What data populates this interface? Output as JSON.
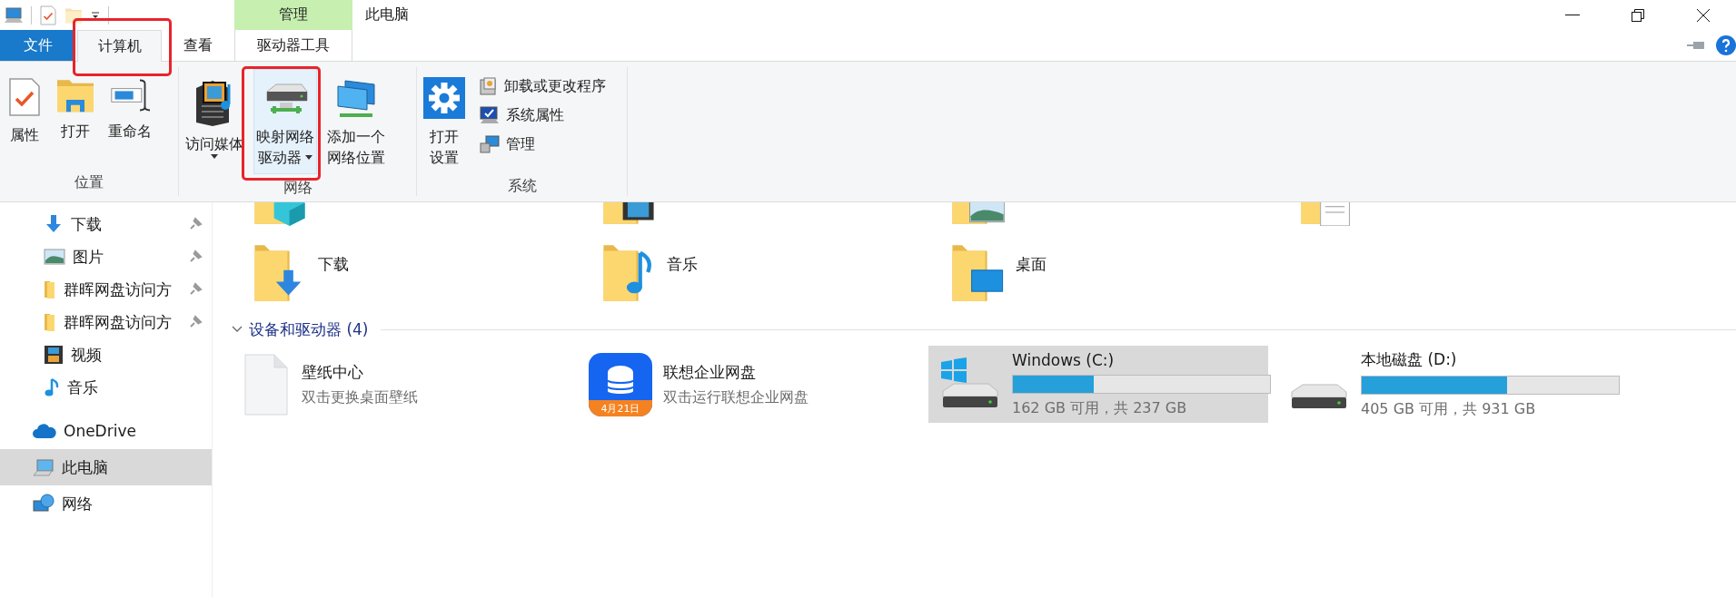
{
  "window": {
    "title": "此电脑",
    "context_header": "管理"
  },
  "tabs": [
    {
      "label": "文件",
      "kind": "file",
      "selected": false
    },
    {
      "label": "计算机",
      "kind": "normal",
      "selected": true,
      "annotated": true
    },
    {
      "label": "查看",
      "kind": "normal",
      "selected": false
    },
    {
      "label": "驱动器工具",
      "kind": "context",
      "selected": false
    }
  ],
  "ribbon": {
    "groups": [
      {
        "label": "位置",
        "commands": [
          {
            "kind": "large",
            "lines": [
              "属性"
            ]
          },
          {
            "kind": "large",
            "lines": [
              "打开"
            ]
          },
          {
            "kind": "large",
            "lines": [
              "重命名"
            ]
          }
        ]
      },
      {
        "label": "网络",
        "commands": [
          {
            "kind": "large",
            "lines": [
              "访问媒体"
            ],
            "dropdown": true
          },
          {
            "kind": "large",
            "lines": [
              "映射网络",
              "驱动器"
            ],
            "dropdown": true,
            "hovered": true,
            "annotated": true
          },
          {
            "kind": "large",
            "lines": [
              "添加一个",
              "网络位置"
            ]
          }
        ]
      },
      {
        "label": "系统",
        "commands": [
          {
            "kind": "large",
            "lines": [
              "打开",
              "设置"
            ]
          },
          {
            "kind": "small",
            "lines": [
              "卸载或更改程序"
            ]
          },
          {
            "kind": "small",
            "lines": [
              "系统属性"
            ]
          },
          {
            "kind": "small",
            "lines": [
              "管理"
            ]
          }
        ]
      }
    ]
  },
  "navigation": {
    "pinned_items": [
      {
        "label": "下载",
        "kind": "downloads",
        "pinned": true,
        "selected": false
      },
      {
        "label": "图片",
        "kind": "pictures",
        "pinned": true,
        "selected": false
      },
      {
        "label": "群晖网盘访问方",
        "kind": "folder",
        "pinned": true,
        "selected": false
      },
      {
        "label": "群晖网盘访问方",
        "kind": "folder",
        "pinned": true,
        "selected": false
      },
      {
        "label": "视频",
        "kind": "videos",
        "pinned": false,
        "selected": false
      },
      {
        "label": "音乐",
        "kind": "music",
        "pinned": false,
        "selected": false
      }
    ],
    "locations": [
      {
        "label": "OneDrive",
        "kind": "cloud",
        "selected": false
      },
      {
        "label": "此电脑",
        "kind": "computer",
        "selected": true
      },
      {
        "label": "网络",
        "kind": "network",
        "selected": false
      }
    ]
  },
  "folders": {
    "partially_visible": [
      {
        "kind": "objects3d"
      },
      {
        "kind": "videos"
      },
      {
        "kind": "pictures"
      },
      {
        "kind": "documents"
      }
    ],
    "items": [
      {
        "label": "下载",
        "kind": "downloads"
      },
      {
        "label": "音乐",
        "kind": "music"
      },
      {
        "label": "桌面",
        "kind": "desktop"
      }
    ]
  },
  "devices": {
    "header": "设备和驱动器 (4)",
    "expanded": true,
    "items": [
      {
        "kind": "shortcut",
        "name": "壁纸中心",
        "description": "双击更换桌面壁纸",
        "selected": false
      },
      {
        "kind": "app",
        "name": "联想企业网盘",
        "description": "双击运行联想企业网盘",
        "badge": "4月21日",
        "selected": false
      },
      {
        "kind": "drive",
        "name": "Windows (C:)",
        "level": 0.316,
        "space": "162 GB 可用，共 237 GB",
        "system": true,
        "selected": true
      },
      {
        "kind": "drive",
        "name": "本地磁盘 (D:)",
        "level": 0.565,
        "space": "405 GB 可用，共 931 GB",
        "system": false,
        "selected": false
      }
    ]
  }
}
